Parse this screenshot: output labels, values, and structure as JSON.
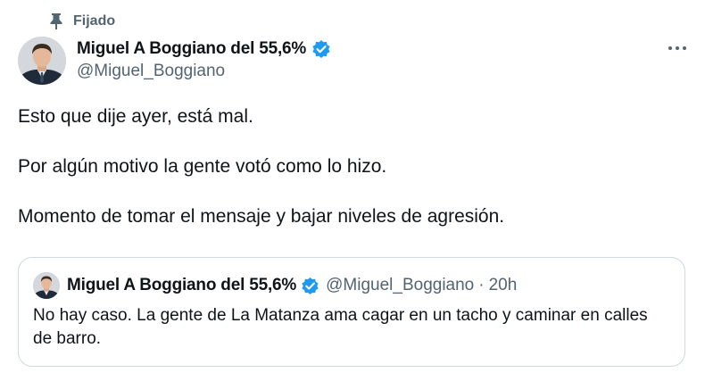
{
  "pinned": {
    "label": "Fijado",
    "icon": "pin-icon"
  },
  "author": {
    "name": "Miguel A Boggiano del 55,6%",
    "handle": "@Miguel_Boggiano",
    "verified_icon": "verified-badge-icon",
    "verified_color": "#1d9bf0"
  },
  "menu": {
    "icon": "more-options-icon"
  },
  "tweet": {
    "paragraphs": [
      "Esto que dije ayer, está mal.",
      "Por algún motivo la gente votó como lo hizo.",
      "Momento de tomar el mensaje y bajar niveles de agresión."
    ]
  },
  "quote": {
    "name": "Miguel A Boggiano del 55,6%",
    "handle": "@Miguel_Boggiano",
    "separator": "·",
    "time": "20h",
    "text": "No hay caso. La gente de La Matanza ama cagar en un tacho y caminar en calles de barro."
  },
  "colors": {
    "text_primary": "#0f1419",
    "text_secondary": "#536471",
    "accent": "#1d9bf0",
    "border": "#cfd9de"
  }
}
